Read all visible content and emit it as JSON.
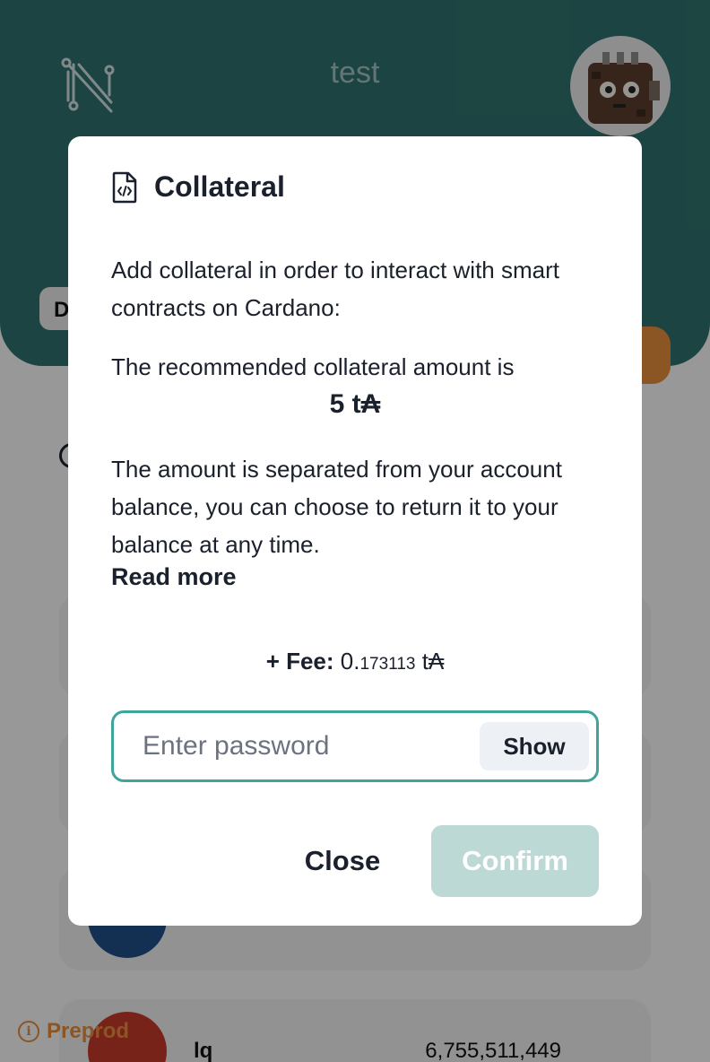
{
  "header": {
    "wallet_name": "test",
    "chip_letter": "D"
  },
  "assets": [
    {
      "name": "",
      "quantity": ""
    },
    {
      "name": "",
      "quantity": ""
    },
    {
      "name": "",
      "quantity": "",
      "icon_letter": "+"
    },
    {
      "name": "lq",
      "quantity": "6,755,511,449"
    }
  ],
  "network": {
    "label": "Preprod"
  },
  "modal": {
    "title": "Collateral",
    "intro": "Add collateral in order to interact with smart contracts on Cardano:",
    "recommended_label": "The recommended collateral amount is",
    "recommended_amount": "5 t₳",
    "explanation": "The amount is separated from your account balance, you can choose to return it to your balance at any time.",
    "read_more": "Read more",
    "fee_label": "+ Fee:",
    "fee_value_whole": "0.",
    "fee_value_decimals": "173113",
    "fee_unit": "t₳",
    "password_placeholder": "Enter password",
    "show_label": "Show",
    "close_label": "Close",
    "confirm_label": "Confirm"
  },
  "colors": {
    "header_bg": "#2e6f6b",
    "accent_teal": "#3fa59a",
    "confirm_disabled": "#bcd9d6",
    "network_orange": "#e08a3a"
  }
}
